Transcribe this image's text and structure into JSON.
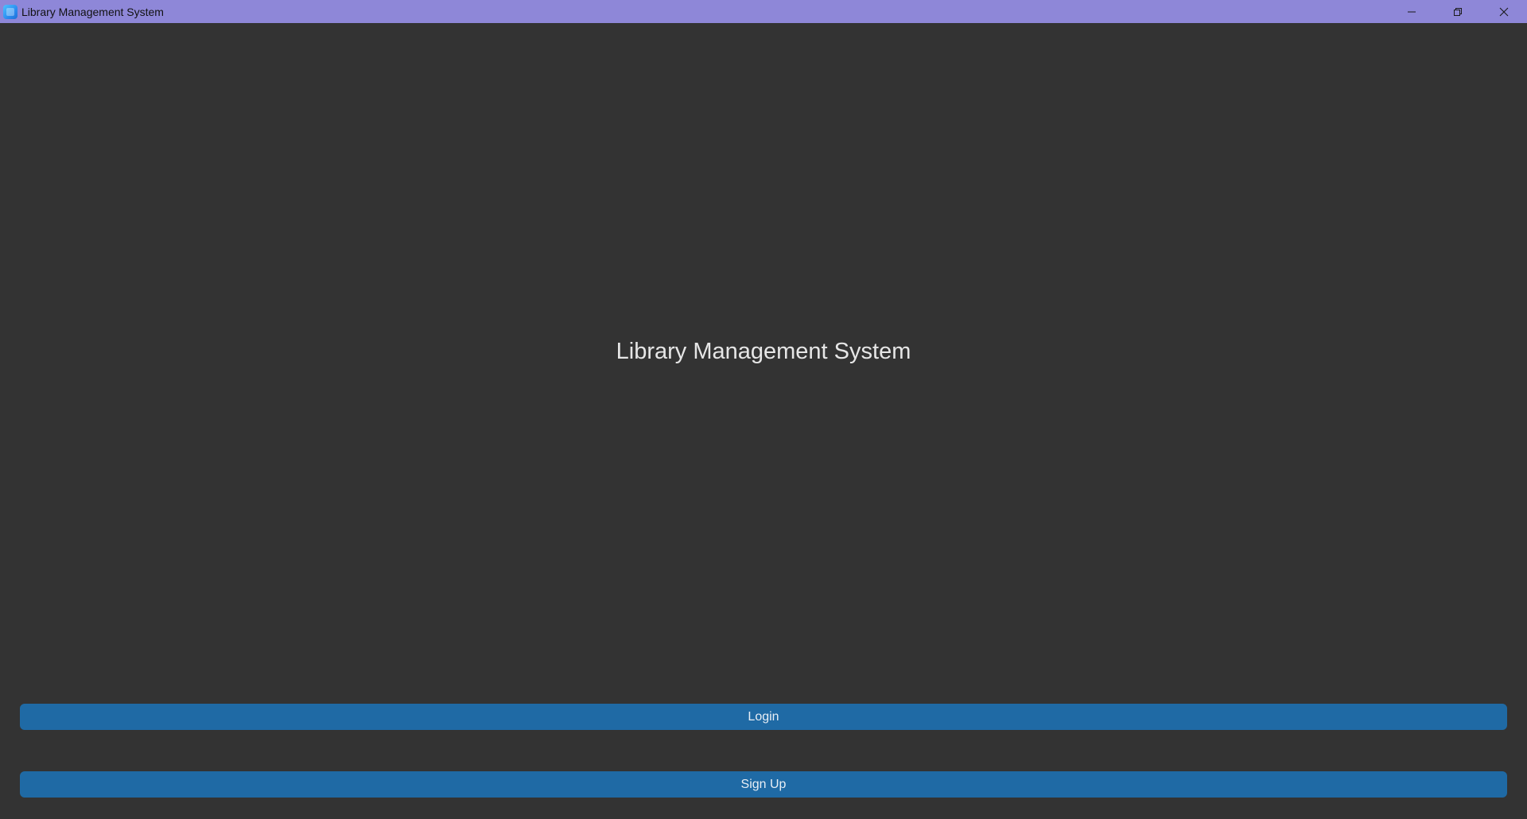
{
  "window": {
    "title": "Library Management System",
    "title_bar_color": "#8e87d8",
    "background_color": "#333333",
    "controls": [
      "minimize-icon",
      "restore-icon",
      "close-icon"
    ]
  },
  "main": {
    "heading": "Library Management System",
    "buttons": [
      {
        "label": "Login",
        "color": "#1f6aa5"
      },
      {
        "label": "Sign Up",
        "color": "#1f6aa5"
      }
    ]
  }
}
